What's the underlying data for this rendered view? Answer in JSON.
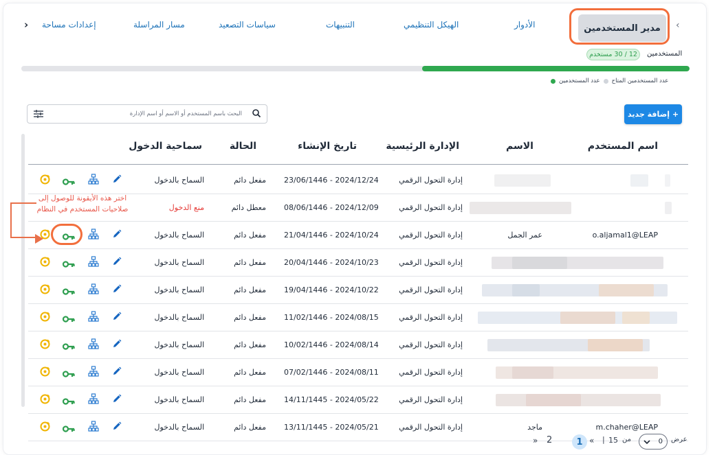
{
  "tabs": {
    "active": "مدير المستخدمين",
    "items": [
      "الأدوار",
      "الهيكل التنظيمي",
      "التنبيهات",
      "سياسات التصعيد",
      "مسار المراسلة",
      "إعدادات مساحة"
    ]
  },
  "usage": {
    "label": "المستخدمين",
    "badge": "12 / 30 مستخدم",
    "fraction": 0.4
  },
  "legend": {
    "used": "عدد المستخدمين",
    "available": "عدد المستخدمين المتاح",
    "used_color": "#2fa84f",
    "available_color": "#d1d5db"
  },
  "search": {
    "placeholder": "البحث باسم المستخدم أو الاسم أو اسم الإدارة"
  },
  "add_button": {
    "label": "+ إضافة جديد"
  },
  "table": {
    "headers": {
      "username": "اسم المستخدم",
      "name": "الاسم",
      "department": "الإدارة الرئيسية",
      "created": "تاريخ الإنشاء",
      "status": "الحالة",
      "access": "سماحية الدخول"
    },
    "rows": [
      {
        "username": "",
        "name": "",
        "department": "إدارة التحول الرقمي",
        "created": "23/06/1446 - 2024/12/24",
        "status": "مفعل دائم",
        "access": "السماح بالدخول"
      },
      {
        "username": "",
        "name": "",
        "department": "إدارة التحول الرقمي",
        "created": "08/06/1446 - 2024/12/09",
        "status": "معطل دائم",
        "access": "منع الدخول"
      },
      {
        "username": "o.aljamal1@LEAP",
        "name": "عمر الجمل",
        "department": "إدارة التحول الرقمي",
        "created": "21/04/1446 - 2024/10/24",
        "status": "مفعل دائم",
        "access": "السماح بالدخول"
      },
      {
        "username": "",
        "name": "",
        "department": "إدارة التحول الرقمي",
        "created": "20/04/1446 - 2024/10/23",
        "status": "مفعل دائم",
        "access": "السماح بالدخول"
      },
      {
        "username": "",
        "name": "",
        "department": "إدارة التحول الرقمي",
        "created": "19/04/1446 - 2024/10/22",
        "status": "مفعل دائم",
        "access": "السماح بالدخول"
      },
      {
        "username": "",
        "name": "",
        "department": "إدارة التحول الرقمي",
        "created": "11/02/1446 - 2024/08/15",
        "status": "مفعل دائم",
        "access": "السماح بالدخول"
      },
      {
        "username": "",
        "name": "",
        "department": "إدارة التحول الرقمي",
        "created": "10/02/1446 - 2024/08/14",
        "status": "مفعل دائم",
        "access": "السماح بالدخول"
      },
      {
        "username": "",
        "name": "",
        "department": "إدارة التحول الرقمي",
        "created": "07/02/1446 - 2024/08/11",
        "status": "مفعل دائم",
        "access": "السماح بالدخول"
      },
      {
        "username": "",
        "name": "",
        "department": "إدارة التحول الرقمي",
        "created": "14/11/1445 - 2024/05/22",
        "status": "مفعل دائم",
        "access": "السماح بالدخول"
      },
      {
        "username": "m.chaher@LEAP",
        "name": "ماجد",
        "department": "إدارة التحول الرقمي",
        "created": "13/11/1445 - 2024/05/21",
        "status": "مفعل دائم",
        "access": "السماح بالدخول"
      }
    ]
  },
  "annotation": {
    "text": "اختر هذه الأيقونة للوصول إلى صلاحيات المستخدم في النظام"
  },
  "pagination": {
    "show_label": "عرض",
    "page_size": "0",
    "of_label": "من",
    "total": "15",
    "pages": [
      "1",
      "2"
    ],
    "current": "1",
    "prev": "«",
    "next": "»",
    "sep": "|"
  }
}
